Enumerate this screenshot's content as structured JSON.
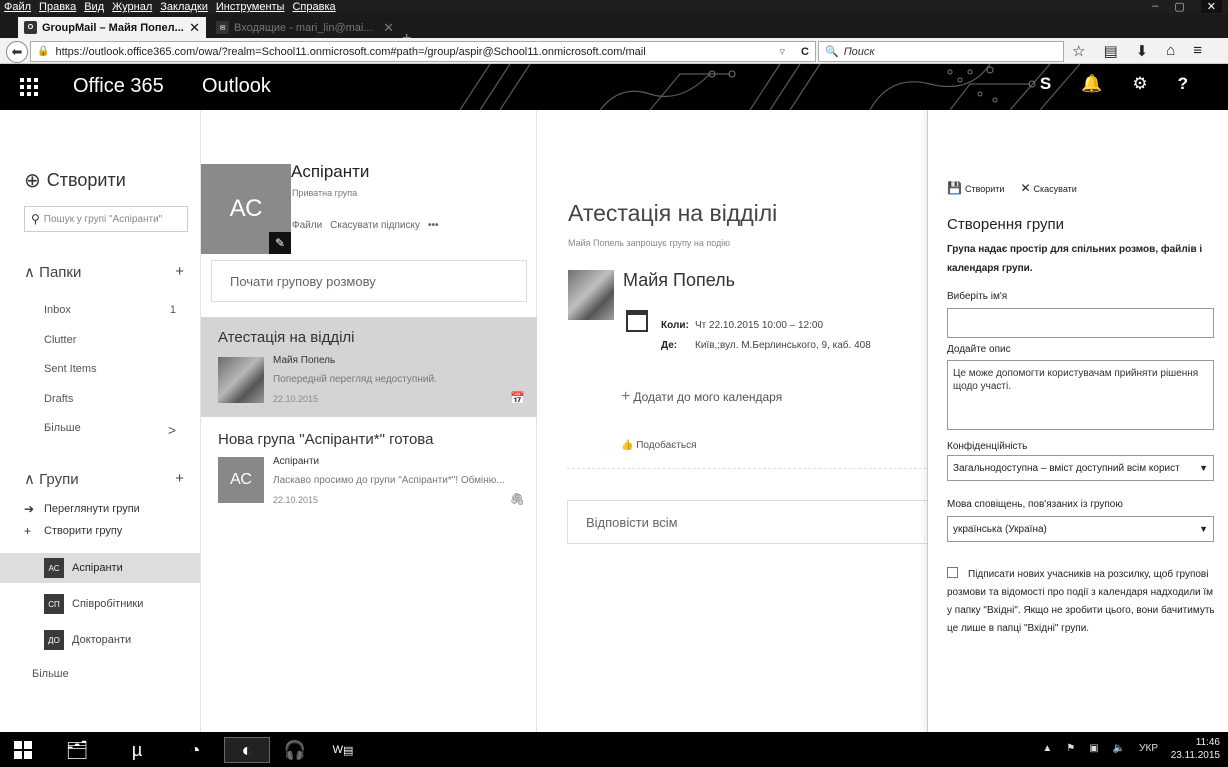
{
  "browser": {
    "menu": [
      "Файл",
      "Правка",
      "Вид",
      "Журнал",
      "Закладки",
      "Инструменты",
      "Справка"
    ],
    "tabs": [
      {
        "label": "GroupMail – Майя Попел...",
        "icon": "outlook-icon"
      },
      {
        "label": "Входящие - mari_lin@mai...",
        "icon": "mail-icon"
      }
    ],
    "url": "https://outlook.office365.com/owa/?realm=School11.onmicrosoft.com#path=/group/aspir@School11.onmicrosoft.com/mail",
    "search_placeholder": "Поиск"
  },
  "header": {
    "brand": "Office 365",
    "app": "Outlook"
  },
  "leftnav": {
    "create_label": "Створити",
    "search_placeholder": "Пошук у групі \"Аспіранти\"",
    "folders_title": "Папки",
    "folders": [
      {
        "label": "Inbox",
        "count": "1"
      },
      {
        "label": "Clutter",
        "count": ""
      },
      {
        "label": "Sent Items",
        "count": ""
      },
      {
        "label": "Drafts",
        "count": ""
      },
      {
        "label": "Більше",
        "count": ""
      }
    ],
    "groups_title": "Групи",
    "browse_groups": "Переглянути групи",
    "create_group": "Створити групу",
    "groups": [
      {
        "abbr": "АС",
        "label": "Аспіранти"
      },
      {
        "abbr": "СП",
        "label": "Співробітники"
      },
      {
        "abbr": "ДО",
        "label": "Докторанти"
      }
    ],
    "more": "Більше"
  },
  "group": {
    "initials": "АС",
    "name": "Аспіранти",
    "type": "Приватна група",
    "files": "Файли",
    "unsubscribe": "Скасувати підписку",
    "more": "•••",
    "start_conversation": "Почати групову розмову"
  },
  "messages": [
    {
      "subject": "Атестація на відділі",
      "from": "Майя Попель",
      "preview": "Попередній перегляд недоступний.",
      "date": "22.10.2015"
    },
    {
      "subject": "Нова група \"Аспіранти*\" готова",
      "from": "Аспіранти",
      "preview": "Ласкаво просимо до групи \"Аспіранти*\"! Обміню...",
      "date": "22.10.2015",
      "initials": "АС"
    }
  ],
  "reading": {
    "title": "Атестація на відділі",
    "invite": "Майя Попель запрошує групу на подію",
    "sender": "Майя Попель",
    "when_label": "Коли:",
    "when": "Чт 22.10.2015 10:00 – 12:00",
    "where_label": "Де:",
    "where": "Київ,;вул. М.Берлинського, 9, каб. 408",
    "add_calendar": "Додати до мого календаря",
    "like": "Подобається",
    "reply_all": "Відповісти всім"
  },
  "panel": {
    "create_btn": "Створити",
    "cancel_btn": "Скасувати",
    "title": "Створення групи",
    "description": "Група надає простір для спільних розмов, файлів і календаря групи.",
    "name_label": "Виберіть ім'я",
    "name_value": "",
    "desc_label": "Додайте опис",
    "desc_placeholder": "Це може допомогти користувачам прийняти рішення щодо участі.",
    "privacy_label": "Конфіденційність",
    "privacy_value": "Загальнодоступна – вміст доступний всім корист",
    "lang_label": "Мова сповіщень, пов'язаних із групою",
    "lang_value": "українська (Україна)",
    "subscribe_text": "Підписати нових учасників на розсилку, щоб групові розмови та відомості про події з календаря надходили їм у папку \"Вхідні\". Якщо не зробити цього, вони бачитимуть це лише в папці \"Вхідні\" групи."
  },
  "taskbar": {
    "lang": "УКР",
    "time": "11:46",
    "date": "23.11.2015",
    "word_label": "W"
  }
}
